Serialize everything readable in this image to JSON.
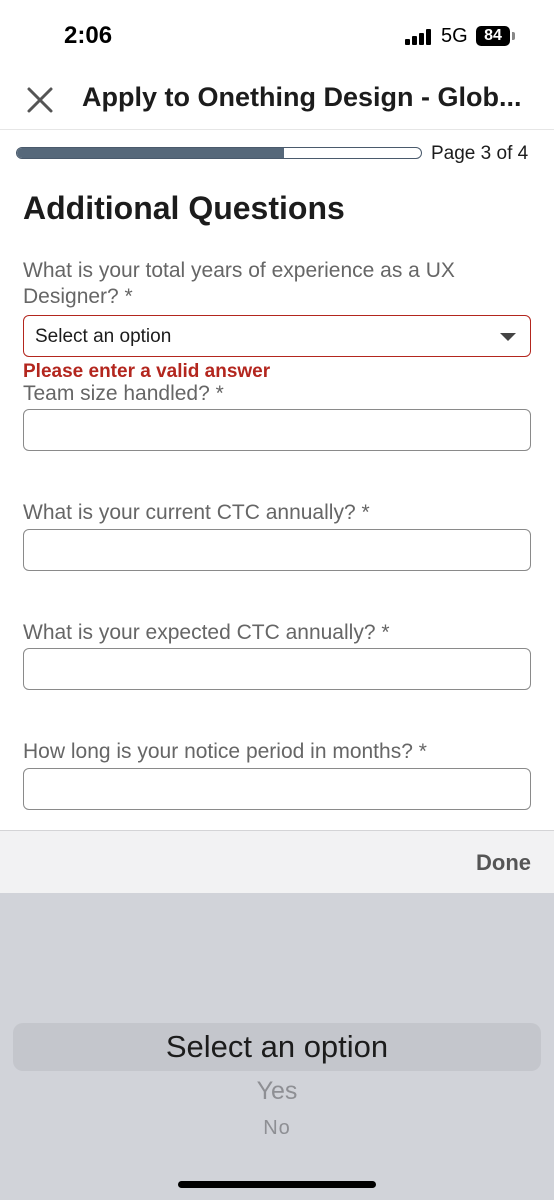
{
  "status_bar": {
    "time": "2:06",
    "network": "5G",
    "battery": "84"
  },
  "header": {
    "title": "Apply to Onething Design - Glob...",
    "close_icon": "close-icon"
  },
  "progress": {
    "fraction": 0.66,
    "page_label": "Page 3 of 4"
  },
  "section_title": "Additional Questions",
  "questions": [
    {
      "label": "What is your total years of experience as a UX Designer? *",
      "type": "select",
      "value": "Select an option",
      "error": "Please enter a valid answer"
    },
    {
      "label": "Team size handled? *",
      "type": "text",
      "value": ""
    },
    {
      "label": "What is your current CTC annually? *",
      "type": "text",
      "value": ""
    },
    {
      "label": "What is your expected CTC annually? *",
      "type": "text",
      "value": ""
    },
    {
      "label": "How long is your notice period in months? *",
      "type": "text",
      "value": ""
    }
  ],
  "accessory": {
    "done_label": "Done"
  },
  "picker": {
    "options": [
      "Select an option",
      "Yes",
      "No"
    ],
    "selected_index": 0
  },
  "colors": {
    "error": "#b3261e",
    "progress_fill": "#56687a",
    "picker_bg": "#d1d3d9"
  }
}
